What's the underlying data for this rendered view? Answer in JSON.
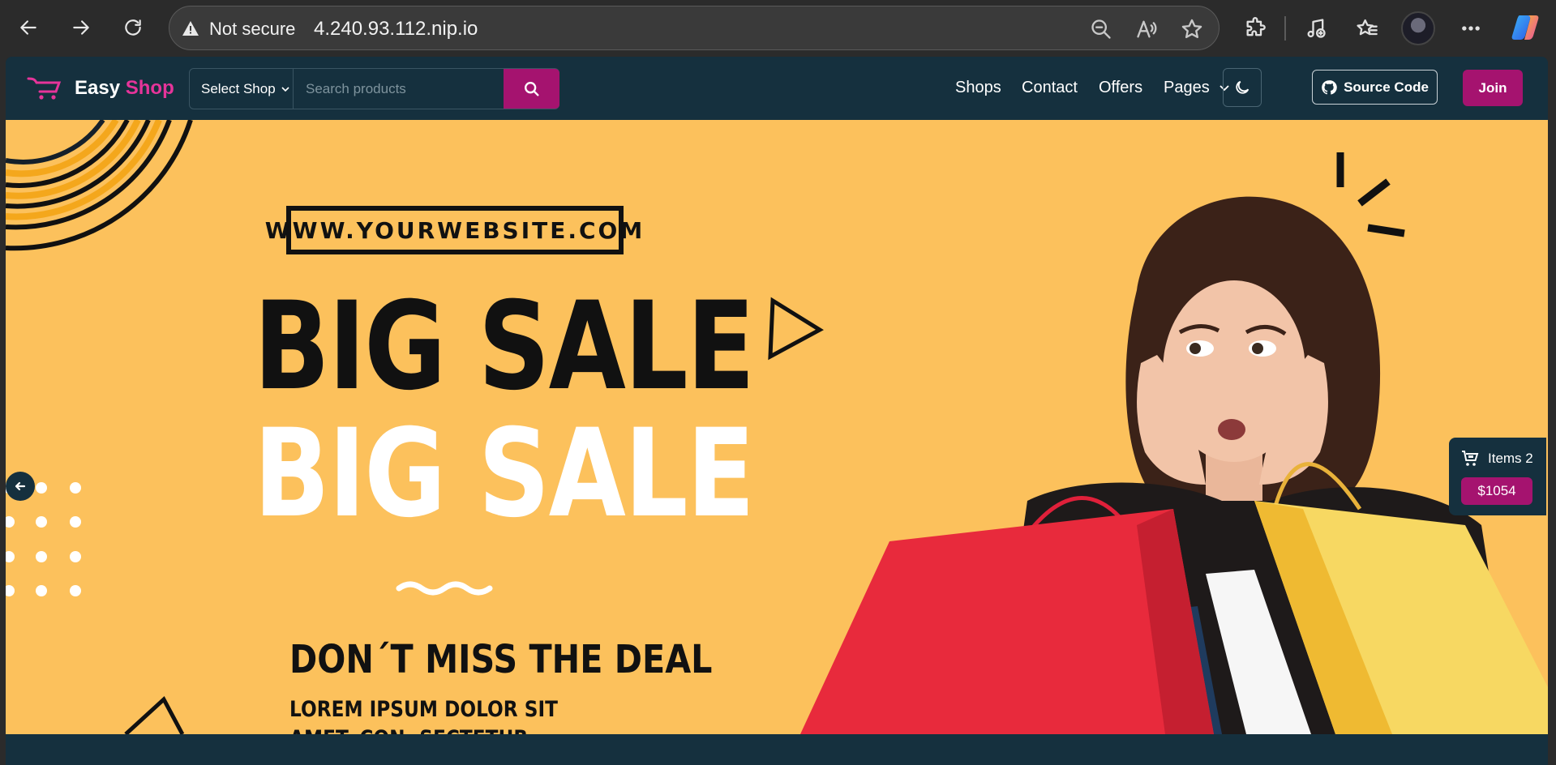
{
  "browser": {
    "security_label": "Not secure",
    "url": "4.240.93.112.nip.io",
    "icons": [
      "back-icon",
      "forward-icon",
      "refresh-icon",
      "warning-icon",
      "zoom-out-icon",
      "read-aloud-icon",
      "favorite-star-icon",
      "extensions-icon",
      "media-control-icon",
      "favorites-icon",
      "more-icon",
      "copilot-icon"
    ]
  },
  "site": {
    "brand_first": "Easy",
    "brand_second": "Shop",
    "brand_color": "#e6349a",
    "accent_color": "#a5136f",
    "header_bg": "#15303e",
    "shop_select_label": "Select Shop",
    "search_placeholder": "Search products",
    "nav": [
      "Shops",
      "Contact",
      "Offers",
      "Pages"
    ],
    "source_code_label": "Source Code",
    "join_label": "Join"
  },
  "banner": {
    "website": "WWW.YOURWEBSITE.COM",
    "headline_1": "BIG SALE",
    "headline_2": "BIG SALE",
    "tagline": "DON´T MISS THE DEAL",
    "lorem": "LOREM IPSUM DOLOR SIT AMET, CON- SECTETUR ADIPISICING ELIT, SED DO",
    "background": "#fcc15c"
  },
  "cart": {
    "items_label": "Items 2",
    "total": "$1054"
  }
}
